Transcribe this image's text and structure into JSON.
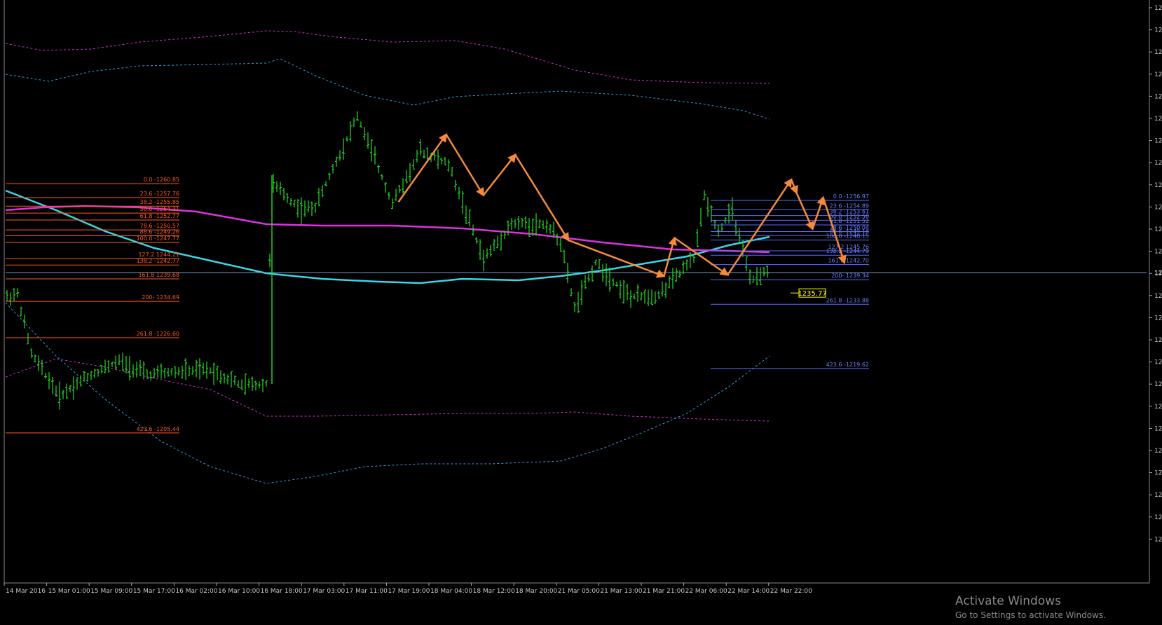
{
  "chart_data": {
    "type": "candlestick",
    "title": "",
    "colors": {
      "background": "#000000",
      "bars": "#22dd22",
      "ma_cyan": "#38d6e6",
      "ma_magenta": "#e030e0",
      "envelope_magenta": "#cc33cc",
      "envelope_cyan": "#2aa0d8",
      "zigzag": "#f58a3c",
      "fib_left": "#ff5a1e",
      "fib_right": "#5a6dff",
      "current_price": "#7799bb",
      "price_label": "#ffff00"
    },
    "y_range": [
      1195,
      1295
    ],
    "y_ticks": [
      "128",
      "128",
      "127",
      "127",
      "127",
      "126",
      "126",
      "126",
      "125",
      "125",
      "125",
      "124",
      "124",
      "124",
      "123",
      "123",
      "123",
      "122",
      "122",
      "121",
      "121",
      "121",
      "120",
      "120",
      "120"
    ],
    "x_ticks": [
      "14 Mar 2016",
      "15 Mar 01:00",
      "15 Mar 09:00",
      "15 Mar 17:00",
      "16 Mar 02:00",
      "16 Mar 10:00",
      "16 Mar 18:00",
      "17 Mar 03:00",
      "17 Mar 11:00",
      "17 Mar 19:00",
      "18 Mar 04:00",
      "18 Mar 12:00",
      "18 Mar 20:00",
      "21 Mar 05:00",
      "21 Mar 13:00",
      "21 Mar 21:00",
      "22 Mar 06:00",
      "22 Mar 14:00",
      "22 Mar 22:00"
    ],
    "current_price": 1235.77,
    "current_price_label": "1235.77",
    "current_tick_label": "124",
    "fib_left": [
      {
        "label": "0.0 -1260.85",
        "value": 1260.85
      },
      {
        "label": "23.6 -1257.76",
        "value": 1257.76
      },
      {
        "label": "38.2 -1255.85",
        "value": 1255.85
      },
      {
        "label": "50.0 -1254.31",
        "value": 1254.31
      },
      {
        "label": "61.8 -1252.77",
        "value": 1252.77
      },
      {
        "label": "78.6 -1250.57",
        "value": 1250.57
      },
      {
        "label": "88.6 -1249.26",
        "value": 1249.26
      },
      {
        "label": "100.0 -1247.77",
        "value": 1247.77
      },
      {
        "label": "127.2 1244.21",
        "value": 1244.21
      },
      {
        "label": "138.2 -1242.77",
        "value": 1242.77
      },
      {
        "label": "161.8 1239.68",
        "value": 1239.68
      },
      {
        "label": "200- 1234.69",
        "value": 1234.69
      },
      {
        "label": "261.8 -1226.60",
        "value": 1226.6
      },
      {
        "label": "423.6 -1205.44",
        "value": 1205.44
      }
    ],
    "fib_right": [
      {
        "label": "0.0 -1256.97",
        "value": 1256.97
      },
      {
        "label": "23.6 -1254.89",
        "value": 1254.89
      },
      {
        "label": "38.2 -1253.61",
        "value": 1253.61
      },
      {
        "label": "50.0 -1252.56",
        "value": 1252.56
      },
      {
        "label": "61.8 -1251.52",
        "value": 1251.52
      },
      {
        "label": "78.6 -1250.04",
        "value": 1250.04
      },
      {
        "label": "88.6 -1249.16",
        "value": 1249.16
      },
      {
        "label": "100.0 -1248.15",
        "value": 1248.15
      },
      {
        "label": "127.2 1245.76",
        "value": 1245.76
      },
      {
        "label": "138.2 -1244.79",
        "value": 1244.79
      },
      {
        "label": "161.8 1242.70",
        "value": 1242.7
      },
      {
        "label": "200- 1239.34",
        "value": 1239.34
      },
      {
        "label": "261.8 -1233.88",
        "value": 1233.88
      },
      {
        "label": "423.6 -1219.62",
        "value": 1219.62
      }
    ],
    "zigzag": [
      {
        "t": "17 Mar 02:00",
        "price": 1256.0
      },
      {
        "t": "17 Mar 11:00",
        "price": 1271.0
      },
      {
        "t": "17 Mar 18:00",
        "price": 1257.5
      },
      {
        "t": "18 Mar 00:00",
        "price": 1266.5
      },
      {
        "t": "18 Mar 10:00",
        "price": 1247.5
      },
      {
        "t": "21 Mar 04:00",
        "price": 1239.5
      },
      {
        "t": "21 Mar 06:00",
        "price": 1248.0
      },
      {
        "t": "21 Mar 16:00",
        "price": 1239.8
      },
      {
        "t": "22 Mar 04:00",
        "price": 1261.0
      },
      {
        "t": "22 Mar 05:00",
        "price": 1258.0
      },
      {
        "t": "22 Mar 08:00",
        "price": 1250.0
      },
      {
        "t": "22 Mar 10:00",
        "price": 1257.0
      },
      {
        "t": "22 Mar 14:00",
        "price": 1242.5
      }
    ]
  },
  "watermark": {
    "line1": "Activate Windows",
    "line2": "Go to Settings to activate Windows."
  }
}
